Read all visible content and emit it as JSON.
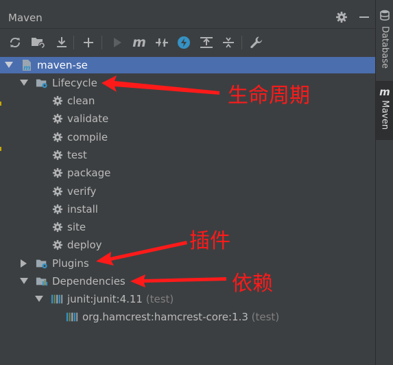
{
  "window": {
    "title": "Maven"
  },
  "side_tabs": [
    {
      "label": "Database",
      "icon": "database-icon"
    },
    {
      "label": "Maven",
      "icon": "maven-m-icon"
    }
  ],
  "toolbar": [
    "reload-icon",
    "add-maven-project-icon",
    "download-sources-icon",
    "plus-icon",
    "run-icon",
    "execute-goal-icon",
    "toggle-offline-icon",
    "skip-tests-icon",
    "show-dependencies-icon",
    "collapse-all-icon",
    "settings-wrench-icon"
  ],
  "tree": {
    "project": "maven-se",
    "lifecycle": {
      "label": "Lifecycle",
      "goals": [
        "clean",
        "validate",
        "compile",
        "test",
        "package",
        "verify",
        "install",
        "site",
        "deploy"
      ]
    },
    "plugins": {
      "label": "Plugins"
    },
    "dependencies": {
      "label": "Dependencies",
      "items": [
        {
          "name": "junit:junit:4.11",
          "scope": "(test)"
        },
        {
          "name": "org.hamcrest:hamcrest-core:1.3",
          "scope": "(test)"
        }
      ]
    }
  },
  "annotations": {
    "lifecycle": "生命周期",
    "plugins": "插件",
    "dependencies": "依赖"
  },
  "colors": {
    "background": "#3c3f41",
    "selection": "#4b6eaf",
    "annotation": "#ff1a1a",
    "folder": "#9aa7b0",
    "maven_blue": "#3592c4"
  }
}
